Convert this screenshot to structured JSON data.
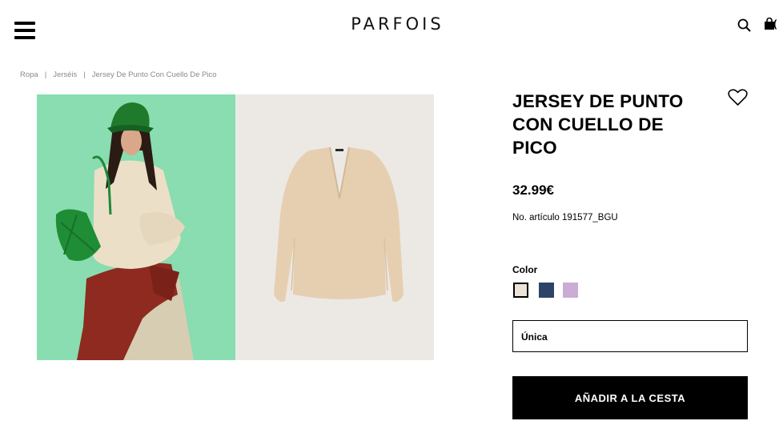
{
  "header": {
    "logo": "PARFOIS",
    "bag_count": "("
  },
  "breadcrumb": [
    {
      "label": "Ropa"
    },
    {
      "label": "Jerséis"
    },
    {
      "label": "Jersey De Punto Con Cuello De Pico"
    }
  ],
  "product": {
    "title": "JERSEY DE PUNTO CON CUELLO DE PICO",
    "price": "32.99€",
    "sku": "No. artículo 191577_BGU",
    "color_label": "Color",
    "colors": [
      {
        "hex": "#ece3d8",
        "selected": true
      },
      {
        "hex": "#2d4468",
        "selected": false
      },
      {
        "hex": "#c9add4",
        "selected": false
      }
    ],
    "size": "Única",
    "add_to_cart_label": "AÑADIR A LA CESTA"
  }
}
